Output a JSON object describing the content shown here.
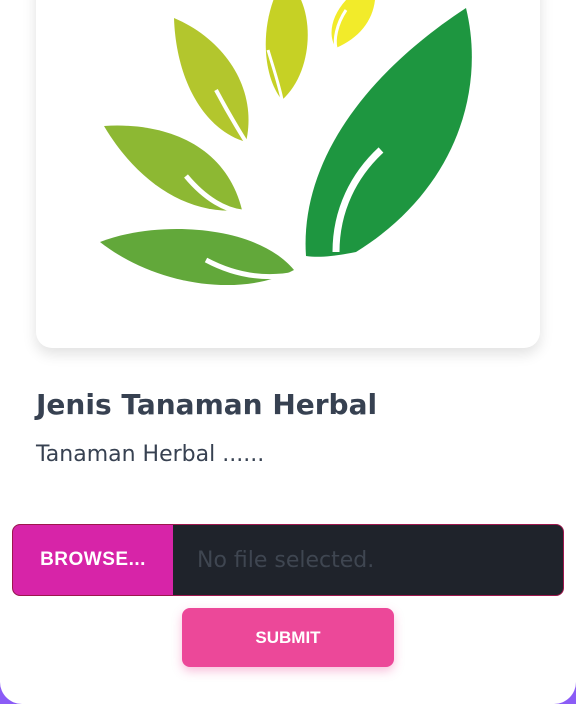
{
  "card": {
    "image": {
      "icon": "herbal-leaf-logo",
      "alt": ""
    },
    "title": "Jenis Tanaman Herbal",
    "description": "Tanaman Herbal ......"
  },
  "upload": {
    "browse_label": "BROWSE...",
    "status_text": "No file selected."
  },
  "submit_label": "SUBMIT",
  "colors": {
    "background": "#8b5cf6",
    "browse": "#d724a8",
    "submit": "#ec4899",
    "field": "#1f232b",
    "leaf_dark": "#1e9640",
    "leaf_yellow": "#f2eb2a"
  }
}
